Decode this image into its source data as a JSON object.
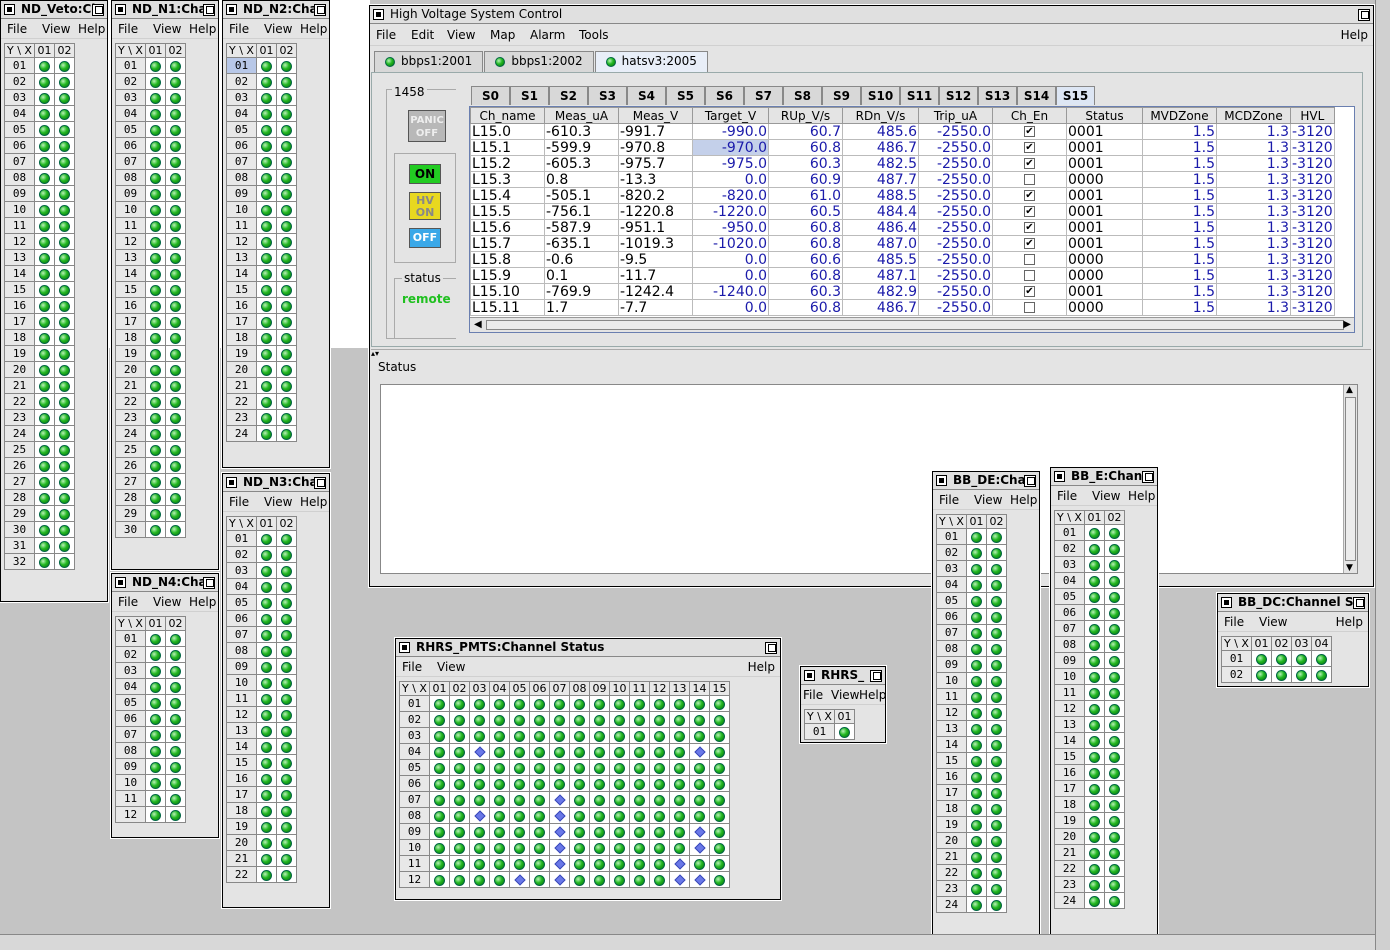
{
  "nd_veto": {
    "title": "ND_Veto:Cl",
    "menus": [
      "File",
      "View",
      "Help"
    ],
    "corner": "Y \\ X",
    "cols": [
      "01",
      "02"
    ],
    "rows": [
      "01",
      "02",
      "03",
      "04",
      "05",
      "06",
      "07",
      "08",
      "09",
      "10",
      "11",
      "12",
      "13",
      "14",
      "15",
      "16",
      "17",
      "18",
      "19",
      "20",
      "21",
      "22",
      "23",
      "24",
      "25",
      "26",
      "27",
      "28",
      "29",
      "30",
      "31",
      "32"
    ]
  },
  "nd_n1": {
    "title": "ND_N1:Cha",
    "menus": [
      "File",
      "View",
      "Help"
    ],
    "corner": "Y \\ X",
    "cols": [
      "01",
      "02"
    ],
    "rows": [
      "01",
      "02",
      "03",
      "04",
      "05",
      "06",
      "07",
      "08",
      "09",
      "10",
      "11",
      "12",
      "13",
      "14",
      "15",
      "16",
      "17",
      "18",
      "19",
      "20",
      "21",
      "22",
      "23",
      "24",
      "25",
      "26",
      "27",
      "28",
      "29",
      "30"
    ]
  },
  "nd_n2": {
    "title": "ND_N2:Cha",
    "menus": [
      "File",
      "View",
      "Help"
    ],
    "corner": "Y \\ X",
    "cols": [
      "01",
      "02"
    ],
    "rows": [
      "01",
      "02",
      "03",
      "04",
      "05",
      "06",
      "07",
      "08",
      "09",
      "10",
      "11",
      "12",
      "13",
      "14",
      "15",
      "16",
      "17",
      "18",
      "19",
      "20",
      "21",
      "22",
      "23",
      "24"
    ]
  },
  "nd_n3": {
    "title": "ND_N3:Cha",
    "menus": [
      "File",
      "View",
      "Help"
    ],
    "corner": "Y \\ X",
    "cols": [
      "01",
      "02"
    ],
    "rows": [
      "01",
      "02",
      "03",
      "04",
      "05",
      "06",
      "07",
      "08",
      "09",
      "10",
      "11",
      "12",
      "13",
      "14",
      "15",
      "16",
      "17",
      "18",
      "19",
      "20",
      "21",
      "22"
    ]
  },
  "nd_n4": {
    "title": "ND_N4:Cha",
    "menus": [
      "File",
      "View",
      "Help"
    ],
    "corner": "Y \\ X",
    "cols": [
      "01",
      "02"
    ],
    "rows": [
      "01",
      "02",
      "03",
      "04",
      "05",
      "06",
      "07",
      "08",
      "09",
      "10",
      "11",
      "12"
    ]
  },
  "hv": {
    "title": "High Voltage System Control",
    "menus": [
      "File",
      "Edit",
      "View",
      "Map",
      "Alarm",
      "Tools"
    ],
    "help": "Help",
    "tabs": [
      "bbps1:2001",
      "bbps1:2002",
      "hatsv3:2005"
    ],
    "crate_id": "1458",
    "panic_label": "PANIC OFF",
    "on_label": "ON",
    "hv_on_label": "HV ON",
    "off_label": "OFF",
    "status_label": "status",
    "status_value": "remote",
    "slot_tabs": [
      "S0",
      "S1",
      "S2",
      "S3",
      "S4",
      "S5",
      "S6",
      "S7",
      "S8",
      "S9",
      "S10",
      "S11",
      "S12",
      "S13",
      "S14",
      "S15"
    ],
    "columns": [
      "Ch_name",
      "Meas_uA",
      "Meas_V",
      "Target_V",
      "RUp_V/s",
      "RDn_V/s",
      "Trip_uA",
      "Ch_En",
      "Status",
      "MVDZone",
      "MCDZone",
      "HVL"
    ],
    "rows": [
      [
        "L15.0",
        "-610.3",
        "-991.7",
        "-990.0",
        "60.7",
        "485.6",
        "-2550.0",
        "1",
        "0001",
        "1.5",
        "1.3",
        "-3120"
      ],
      [
        "L15.1",
        "-599.9",
        "-970.8",
        "-970.0",
        "60.8",
        "486.7",
        "-2550.0",
        "1",
        "0001",
        "1.5",
        "1.3",
        "-3120"
      ],
      [
        "L15.2",
        "-605.3",
        "-975.7",
        "-975.0",
        "60.3",
        "482.5",
        "-2550.0",
        "1",
        "0001",
        "1.5",
        "1.3",
        "-3120"
      ],
      [
        "L15.3",
        "0.8",
        "-13.3",
        "0.0",
        "60.9",
        "487.7",
        "-2550.0",
        "0",
        "0000",
        "1.5",
        "1.3",
        "-3120"
      ],
      [
        "L15.4",
        "-505.1",
        "-820.2",
        "-820.0",
        "61.0",
        "488.5",
        "-2550.0",
        "1",
        "0001",
        "1.5",
        "1.3",
        "-3120"
      ],
      [
        "L15.5",
        "-756.1",
        "-1220.8",
        "-1220.0",
        "60.5",
        "484.4",
        "-2550.0",
        "1",
        "0001",
        "1.5",
        "1.3",
        "-3120"
      ],
      [
        "L15.6",
        "-587.9",
        "-951.1",
        "-950.0",
        "60.8",
        "486.4",
        "-2550.0",
        "1",
        "0001",
        "1.5",
        "1.3",
        "-3120"
      ],
      [
        "L15.7",
        "-635.1",
        "-1019.3",
        "-1020.0",
        "60.8",
        "487.0",
        "-2550.0",
        "1",
        "0001",
        "1.5",
        "1.3",
        "-3120"
      ],
      [
        "L15.8",
        "-0.6",
        "-9.5",
        "0.0",
        "60.6",
        "485.5",
        "-2550.0",
        "0",
        "0000",
        "1.5",
        "1.3",
        "-3120"
      ],
      [
        "L15.9",
        "0.1",
        "-11.7",
        "0.0",
        "60.8",
        "487.1",
        "-2550.0",
        "0",
        "0000",
        "1.5",
        "1.3",
        "-3120"
      ],
      [
        "L15.10",
        "-769.9",
        "-1242.4",
        "-1240.0",
        "60.3",
        "482.9",
        "-2550.0",
        "1",
        "0001",
        "1.5",
        "1.3",
        "-3120"
      ],
      [
        "L15.11",
        "1.7",
        "-7.7",
        "0.0",
        "60.8",
        "486.7",
        "-2550.0",
        "0",
        "0000",
        "1.5",
        "1.3",
        "-3120"
      ]
    ],
    "status_section": "Status"
  },
  "rhrs_pmts": {
    "title": "RHRS_PMTS:Channel Status",
    "menus": [
      "File",
      "View"
    ],
    "help": "Help",
    "corner": "Y \\ X",
    "cols": [
      "01",
      "02",
      "03",
      "04",
      "05",
      "06",
      "07",
      "08",
      "09",
      "10",
      "11",
      "12",
      "13",
      "14",
      "15"
    ],
    "rows": [
      "01",
      "02",
      "03",
      "04",
      "05",
      "06",
      "07",
      "08",
      "09",
      "10",
      "11",
      "12"
    ],
    "diamonds": [
      "04-03",
      "04-14",
      "07-07",
      "08-03",
      "08-07",
      "09-07",
      "09-14",
      "10-07",
      "10-14",
      "11-07",
      "11-13",
      "12-05",
      "12-07",
      "12-13",
      "12-14"
    ]
  },
  "rhrs_small": {
    "title": "RHRS_",
    "menus": [
      "File",
      "View",
      "Help"
    ],
    "corner": "Y \\ X",
    "cols": [
      "01"
    ],
    "rows": [
      "01"
    ]
  },
  "bb_de": {
    "title": "BB_DE:Cha",
    "menus": [
      "File",
      "View",
      "Help"
    ],
    "corner": "Y \\ X",
    "cols": [
      "01",
      "02"
    ],
    "rows": [
      "01",
      "02",
      "03",
      "04",
      "05",
      "06",
      "07",
      "08",
      "09",
      "10",
      "11",
      "12",
      "13",
      "14",
      "15",
      "16",
      "17",
      "18",
      "19",
      "20",
      "21",
      "22",
      "23",
      "24"
    ]
  },
  "bb_e": {
    "title": "BB_E:Chan",
    "menus": [
      "File",
      "View",
      "Help"
    ],
    "corner": "Y \\ X",
    "cols": [
      "01",
      "02"
    ],
    "rows": [
      "01",
      "02",
      "03",
      "04",
      "05",
      "06",
      "07",
      "08",
      "09",
      "10",
      "11",
      "12",
      "13",
      "14",
      "15",
      "16",
      "17",
      "18",
      "19",
      "20",
      "21",
      "22",
      "23",
      "24"
    ]
  },
  "bb_dc": {
    "title": "BB_DC:Channel St",
    "menus": [
      "File",
      "View"
    ],
    "help": "Help",
    "corner": "Y \\ X",
    "cols": [
      "01",
      "02",
      "03",
      "04"
    ],
    "rows": [
      "01",
      "02"
    ]
  }
}
